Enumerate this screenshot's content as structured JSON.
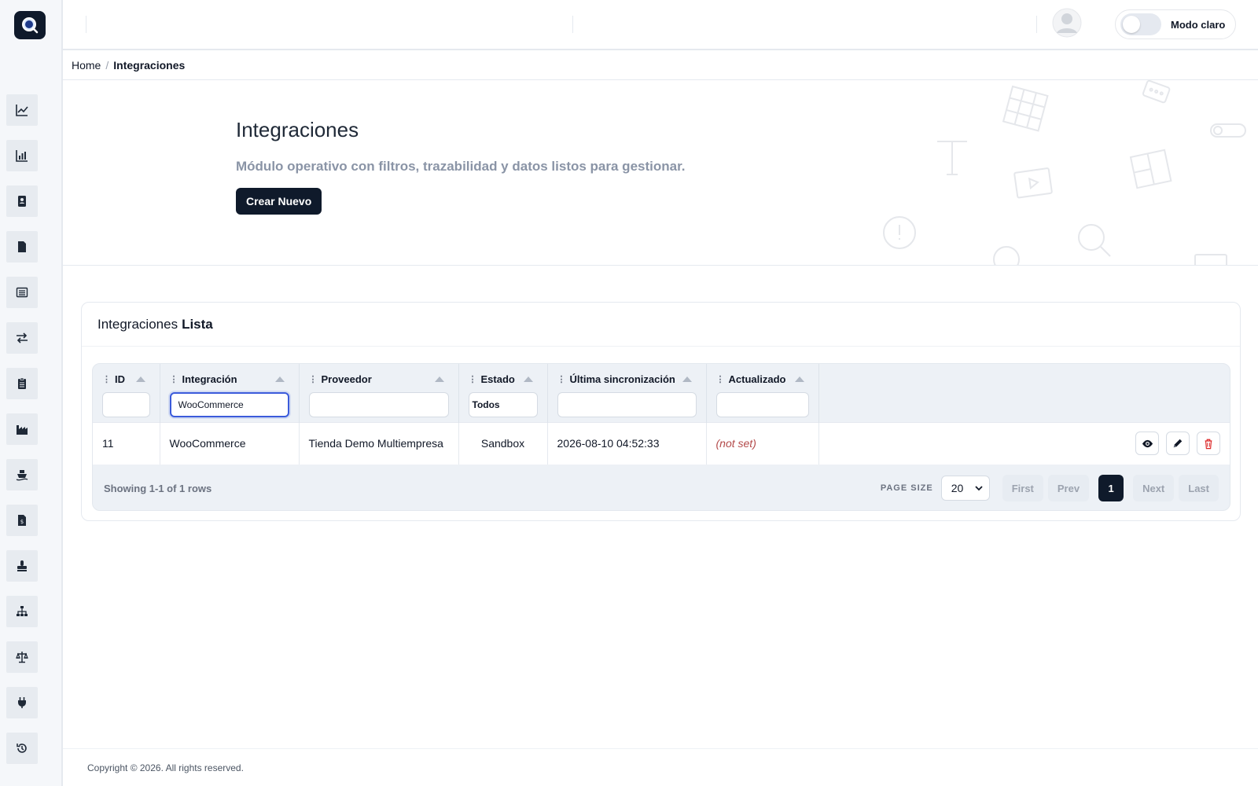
{
  "app": {
    "accent": "#0f1a2b",
    "logo_icon": "magnifier-logo-icon"
  },
  "sidebar": {
    "items": [
      {
        "icon": "line-chart-icon"
      },
      {
        "icon": "bar-chart-icon"
      },
      {
        "icon": "contact-book-icon"
      },
      {
        "icon": "document-icon"
      },
      {
        "icon": "list-icon"
      },
      {
        "icon": "transfer-arrows-icon"
      },
      {
        "icon": "clipboard-icon"
      },
      {
        "icon": "factory-icon"
      },
      {
        "icon": "ship-icon"
      },
      {
        "icon": "invoice-icon"
      },
      {
        "icon": "stamp-icon"
      },
      {
        "icon": "sitemap-icon"
      },
      {
        "icon": "balance-scale-icon"
      },
      {
        "icon": "plug-icon"
      },
      {
        "icon": "history-icon"
      }
    ]
  },
  "topbar": {
    "mode_label": "Modo claro"
  },
  "breadcrumb": {
    "home": "Home",
    "separator": "/",
    "current": "Integraciones"
  },
  "hero": {
    "title": "Integraciones",
    "subtitle": "Módulo operativo con filtros, trazabilidad y datos listos para gestionar.",
    "create_button": "Crear Nuevo"
  },
  "card": {
    "title_main": "Integraciones",
    "title_bold": "Lista"
  },
  "table": {
    "columns": [
      {
        "label": "ID",
        "filter": ""
      },
      {
        "label": "Integración",
        "filter": "WooCommerce"
      },
      {
        "label": "Proveedor",
        "filter": ""
      },
      {
        "label": "Estado",
        "filter": "Todos"
      },
      {
        "label": "Última sincronización",
        "filter": ""
      },
      {
        "label": "Actualizado",
        "filter": ""
      }
    ],
    "rows": [
      {
        "id": "11",
        "integracion": "WooCommerce",
        "proveedor": "Tienda Demo Multiempresa",
        "estado": "Sandbox",
        "ultima_sync": "2026-08-10 04:52:33",
        "actualizado": "(not set)"
      }
    ],
    "summary": "Showing 1-1 of 1 rows",
    "page_size_label": "PAGE SIZE",
    "page_size_value": "20",
    "pager": {
      "first": "First",
      "prev": "Prev",
      "current": "1",
      "next": "Next",
      "last": "Last"
    }
  },
  "footer": {
    "copyright": "Copyright © 2026. All rights reserved."
  }
}
